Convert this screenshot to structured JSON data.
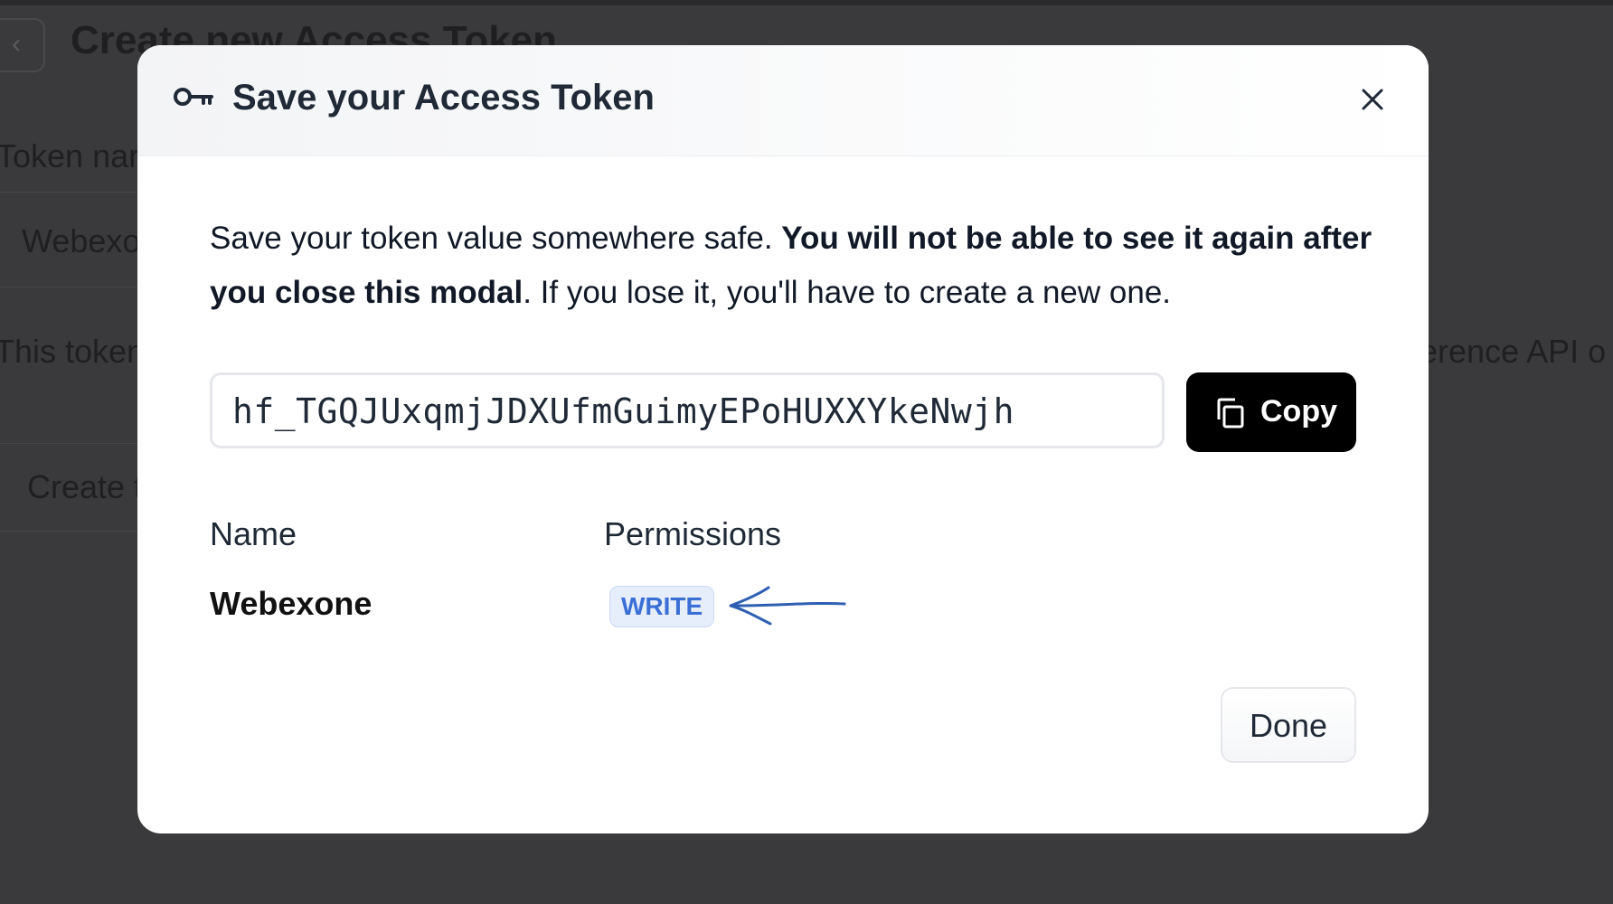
{
  "background_page": {
    "back_glyph": "‹",
    "title": "Create new Access Token",
    "token_name_label": "Token nar",
    "token_name_value": "Webexo",
    "description_left": "This token",
    "description_right": "erence API o",
    "create_label": "Create t"
  },
  "modal": {
    "title": "Save your Access Token",
    "message": {
      "part1": "Save your token value somewhere safe. ",
      "bold": "You will not be able to see it again after you close this modal",
      "part2": ". If you lose it, you'll have to create a new one."
    },
    "token_value": "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",
    "copy_label": "Copy",
    "columns": {
      "name": "Name",
      "permissions": "Permissions"
    },
    "token": {
      "name": "Webexone",
      "permission": "WRITE"
    },
    "done_label": "Done"
  },
  "colors": {
    "overlay": "#3a3a3c",
    "badge_text": "#3b6fd6",
    "badge_bg": "#e6eefc",
    "annotation_arrow": "#2f5fb3",
    "copy_button_bg": "#000000"
  },
  "icons": {
    "header": "key-icon",
    "close": "close-icon",
    "copy": "copy-icon",
    "annotation": "hand-drawn-arrow"
  }
}
